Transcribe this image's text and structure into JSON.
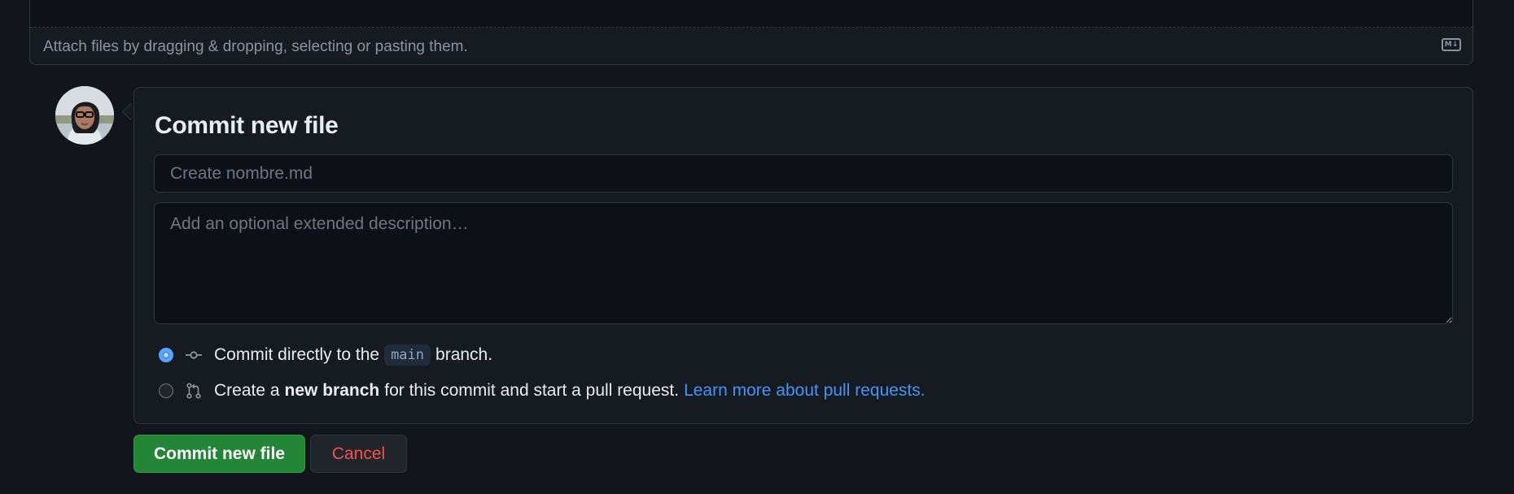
{
  "editor": {
    "attach_text": "Attach files by dragging & dropping, selecting or pasting them.",
    "markdown_icon": "markdown-icon"
  },
  "commit": {
    "title": "Commit new file",
    "summary_placeholder": "Create nombre.md",
    "summary_value": "",
    "description_placeholder": "Add an optional extended description…",
    "description_value": "",
    "option_direct": {
      "selected": true,
      "icon": "git-commit-icon",
      "text_before": "Commit directly to the",
      "branch": "main",
      "text_after": "branch."
    },
    "option_new_branch": {
      "selected": false,
      "icon": "git-pull-request-icon",
      "text_before": "Create a",
      "bold": "new branch",
      "text_after": "for this commit and start a pull request.",
      "link_text": "Learn more about pull requests."
    }
  },
  "buttons": {
    "commit_label": "Commit new file",
    "cancel_label": "Cancel"
  },
  "colors": {
    "background": "#13151c",
    "primary_button": "#238636",
    "cancel_text": "#f85149",
    "link": "#4493f8",
    "radio_selected": "#58a6ff"
  }
}
